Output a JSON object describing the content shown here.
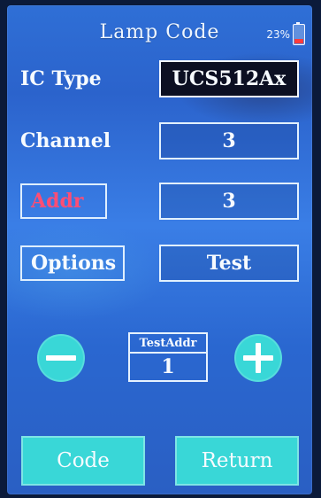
{
  "header": {
    "title": "Lamp Code",
    "battery_percent": "23%"
  },
  "fields": {
    "ic_type": {
      "label": "IC Type",
      "value": "UCS512Ax"
    },
    "channel": {
      "label": "Channel",
      "value": "3"
    },
    "addr": {
      "label": "Addr",
      "value": "3"
    },
    "options": {
      "label": "Options",
      "value": "Test"
    }
  },
  "test_addr": {
    "label": "TestAddr",
    "value": "1"
  },
  "buttons": {
    "code": "Code",
    "return": "Return"
  },
  "colors": {
    "accent": "#39d7d7",
    "addr_label": "#ff4d74",
    "battery_low": "#ff3b3b"
  },
  "icons": {
    "minus": "minus-circle-icon",
    "plus": "plus-circle-icon",
    "battery": "battery-icon"
  }
}
